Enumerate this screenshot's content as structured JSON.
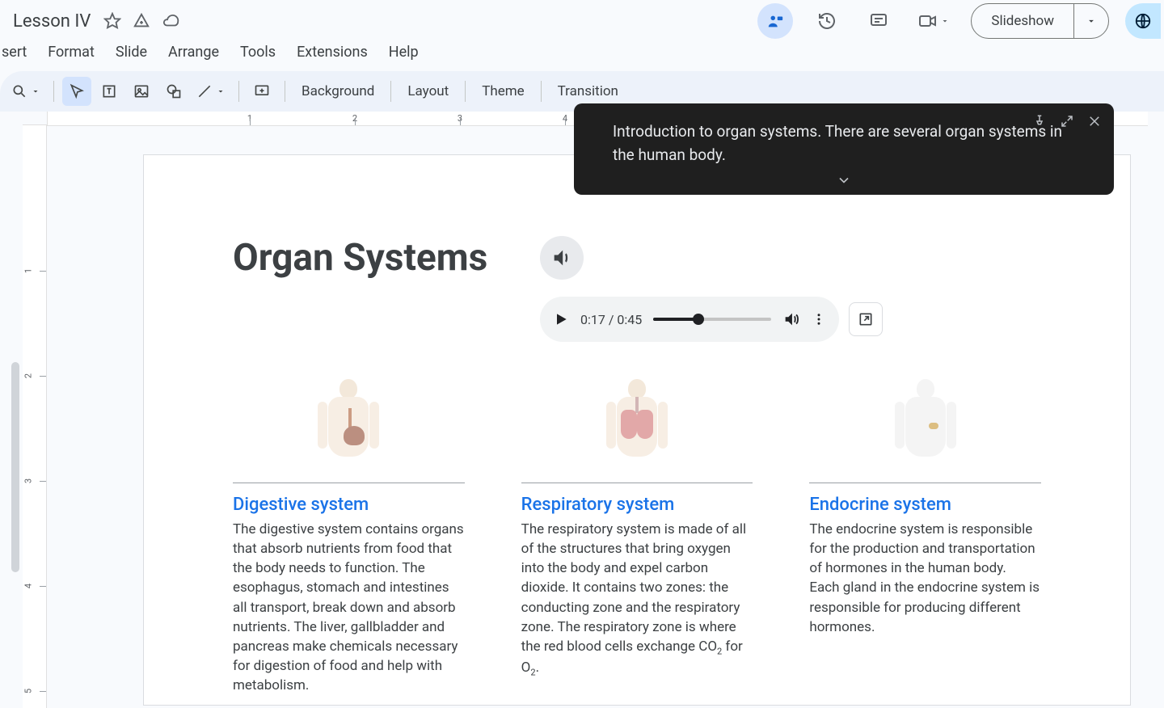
{
  "doc": {
    "title": "Lesson IV"
  },
  "menu": {
    "insert": "sert",
    "format": "Format",
    "slide": "Slide",
    "arrange": "Arrange",
    "tools": "Tools",
    "extensions": "Extensions",
    "help": "Help"
  },
  "toolbar": {
    "background": "Background",
    "layout": "Layout",
    "theme": "Theme",
    "transition": "Transition"
  },
  "header_actions": {
    "slideshow": "Slideshow"
  },
  "caption": {
    "text": "Introduction to organ systems. There are several organ systems in the human body."
  },
  "audio": {
    "current": "0:17",
    "total": "0:45",
    "display": "0:17 / 0:45",
    "progress_pct": 38
  },
  "slide": {
    "title": "Organ Systems",
    "columns": [
      {
        "heading": "Digestive system",
        "body": "The digestive system contains organs that absorb nutrients from food that the body needs to function. The esophagus, stomach and intestines all transport, break down and absorb nutrients. The liver, gallbladder and pancreas make chemicals necessary for digestion of food and help with metabolism."
      },
      {
        "heading": "Respiratory system",
        "body_html": "The respiratory system is made of all of the structures that bring oxygen into the body and expel carbon dioxide. It contains two zones: the conducting zone and the respiratory zone. The respiratory zone is where the red blood cells exchange CO<sub>2</sub> for O<sub>2</sub>."
      },
      {
        "heading": "Endocrine system",
        "body": "The endocrine system is responsible for the production and transportation of hormones in the human body.\nEach gland in the endocrine system is responsible for producing different hormones."
      }
    ]
  },
  "ruler": {
    "h": [
      "1",
      "2",
      "3",
      "4"
    ],
    "v": [
      "1",
      "2",
      "3",
      "4",
      "5"
    ]
  }
}
